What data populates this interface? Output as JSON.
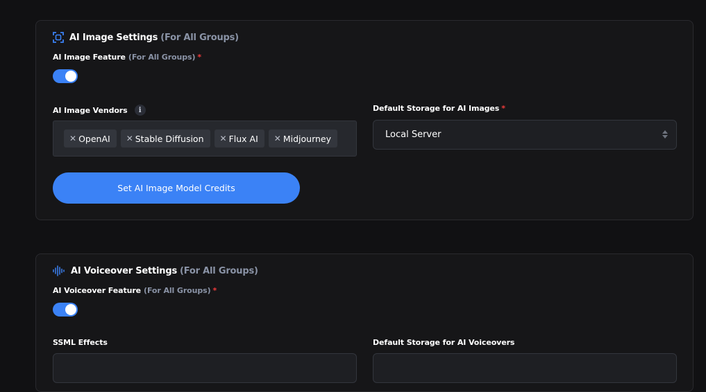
{
  "image_settings": {
    "title": "AI Image Settings",
    "title_suffix": "(For All Groups)",
    "feature_label": "AI Image Feature",
    "feature_suffix": "(For All Groups)",
    "required_mark": "*",
    "feature_enabled": true,
    "vendors_label": "AI Image Vendors",
    "info_glyph": "i",
    "vendors": [
      "OpenAI",
      "Stable Diffusion",
      "Flux AI",
      "Midjourney"
    ],
    "remove_glyph": "✕",
    "storage_label": "Default Storage for AI Images",
    "storage_value": "Local Server",
    "credits_button": "Set AI Image Model Credits"
  },
  "voice_settings": {
    "title": "AI Voiceover Settings",
    "title_suffix": "(For All Groups)",
    "feature_label": "AI Voiceover Feature",
    "feature_suffix": "(For All Groups)",
    "required_mark": "*",
    "feature_enabled": true,
    "ssml_label": "SSML Effects",
    "storage_label": "Default Storage for AI Voiceovers"
  },
  "colors": {
    "accent": "#3b82f6",
    "required": "#ef3b3b",
    "muted": "#8a93a6",
    "background": "#111113",
    "card": "#161618"
  },
  "icons": {
    "image_section": "image-frame-icon",
    "voice_section": "waveform-icon",
    "info": "info-icon",
    "tag_remove": "close-icon",
    "select_arrows": "sort-arrows-icon"
  }
}
